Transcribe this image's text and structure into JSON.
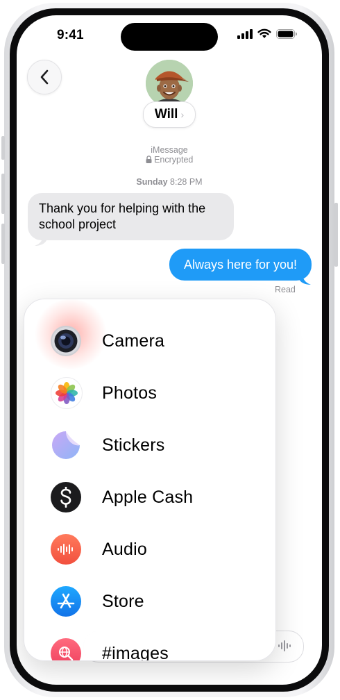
{
  "status_bar": {
    "time": "9:41"
  },
  "header": {
    "contact_name": "Will",
    "name_chevron": "›",
    "service": "iMessage",
    "encryption": "Encrypted",
    "avatar_icon": "memoji-avatar-icon"
  },
  "conversation": {
    "timestamp_day": "Sunday",
    "timestamp_time": "8:28 PM",
    "messages": [
      {
        "direction": "incoming",
        "text": "Thank you for helping with the school project"
      },
      {
        "direction": "outgoing",
        "text": "Always here for you!"
      }
    ],
    "read_status": "Read"
  },
  "apps_menu": {
    "items": [
      {
        "label": "Camera",
        "icon": "camera-icon"
      },
      {
        "label": "Photos",
        "icon": "photos-icon"
      },
      {
        "label": "Stickers",
        "icon": "stickers-icon"
      },
      {
        "label": "Apple Cash",
        "icon": "apple-cash-icon"
      },
      {
        "label": "Audio",
        "icon": "audio-icon"
      },
      {
        "label": "Store",
        "icon": "app-store-icon"
      },
      {
        "label": "#images",
        "icon": "images-search-icon"
      }
    ]
  },
  "colors": {
    "outgoing_bubble": "#1f9bf7",
    "incoming_bubble": "#e9e9eb",
    "secondary_text": "#8e8e93"
  }
}
